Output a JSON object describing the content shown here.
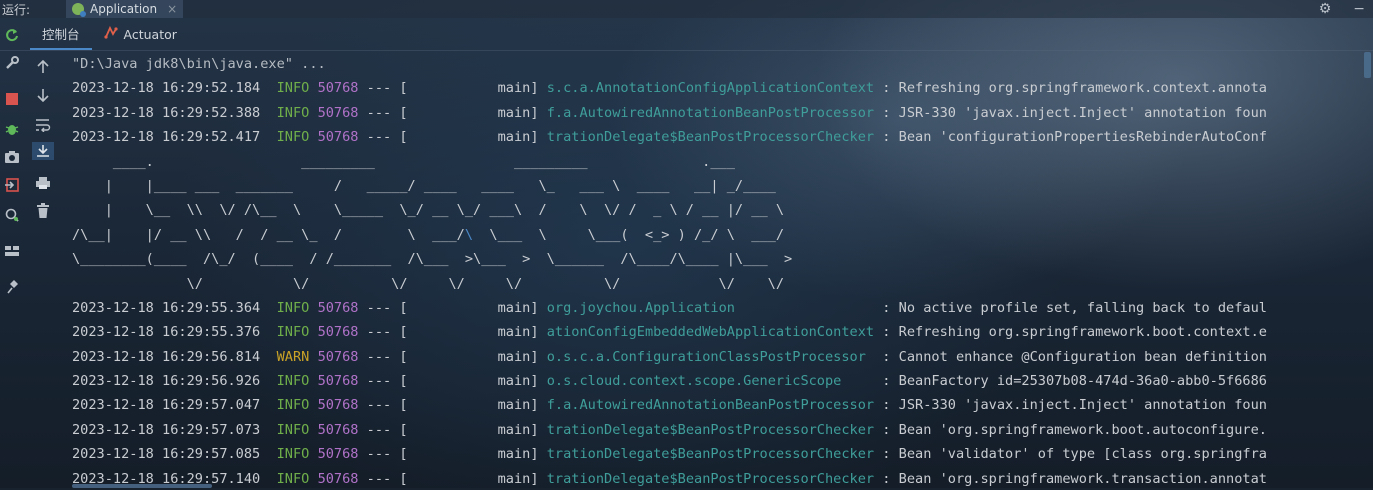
{
  "top_bar": {
    "run_label": "运行:",
    "tab_title": "Application",
    "close": "×",
    "gear": "⚙",
    "minus": "−"
  },
  "subtabs": {
    "console": "控制台",
    "actuator": "Actuator"
  },
  "command_line": "\"D:\\Java jdk8\\bin\\java.exe\" ...",
  "log_before": [
    {
      "ts": "2023-12-18 16:29:52.184",
      "level": "INFO",
      "pid": "50768",
      "sep": "--- [",
      "thread": "           main]",
      "logger": "s.c.a.AnnotationConfigApplicationContext",
      "msg": " : Refreshing org.springframework.context.annota"
    },
    {
      "ts": "2023-12-18 16:29:52.388",
      "level": "INFO",
      "pid": "50768",
      "sep": "--- [",
      "thread": "           main]",
      "logger": "f.a.AutowiredAnnotationBeanPostProcessor",
      "msg": " : JSR-330 'javax.inject.Inject' annotation foun"
    },
    {
      "ts": "2023-12-18 16:29:52.417",
      "level": "INFO",
      "pid": "50768",
      "sep": "--- [",
      "thread": "           main]",
      "logger": "trationDelegate$BeanPostProcessorChecker",
      "msg": " : Bean 'configurationPropertiesRebinderAutoConf"
    }
  ],
  "banner": [
    "     ____.                  _________                 _________              .___",
    "    |    |____ ___  _______     /   _____/ ____   ____   \\_   ___ \\  ____   __| _/____",
    "    |    \\__  \\\\  \\/ /\\__  \\    \\_____  \\_/ __ \\_/ ___\\  /    \\  \\/ /  _ \\ / __ |/ __ \\",
    "/\\__|    |/ __ \\\\   /  / __ \\_  /        \\  ___/",
    "\\________(____  /\\_/  (____  / /_______  /\\___  >\\___  >  \\______  /\\____/\\____ |\\___  >",
    "              \\/           \\/          \\/     \\/     \\/          \\/            \\/    \\/"
  ],
  "banner_line4_hl": "\\",
  "banner_line4_rest": "  \\___  \\     \\___(  <_> ) /_/ \\  ___/",
  "log_after": [
    {
      "ts": "2023-12-18 16:29:55.364",
      "level": "INFO",
      "pid": "50768",
      "sep": "--- [",
      "thread": "           main]",
      "logger": "org.joychou.Application                 ",
      "msg": " : No active profile set, falling back to defaul"
    },
    {
      "ts": "2023-12-18 16:29:55.376",
      "level": "INFO",
      "pid": "50768",
      "sep": "--- [",
      "thread": "           main]",
      "logger": "ationConfigEmbeddedWebApplicationContext",
      "msg": " : Refreshing org.springframework.boot.context.e"
    },
    {
      "ts": "2023-12-18 16:29:56.814",
      "level": "WARN",
      "pid": "50768",
      "sep": "--- [",
      "thread": "           main]",
      "logger": "o.s.c.a.ConfigurationClassPostProcessor ",
      "msg": " : Cannot enhance @Configuration bean definition"
    },
    {
      "ts": "2023-12-18 16:29:56.926",
      "level": "INFO",
      "pid": "50768",
      "sep": "--- [",
      "thread": "           main]",
      "logger": "o.s.cloud.context.scope.GenericScope    ",
      "msg": " : BeanFactory id=25307b08-474d-36a0-abb0-5f6686"
    },
    {
      "ts": "2023-12-18 16:29:57.047",
      "level": "INFO",
      "pid": "50768",
      "sep": "--- [",
      "thread": "           main]",
      "logger": "f.a.AutowiredAnnotationBeanPostProcessor",
      "msg": " : JSR-330 'javax.inject.Inject' annotation foun"
    },
    {
      "ts": "2023-12-18 16:29:57.073",
      "level": "INFO",
      "pid": "50768",
      "sep": "--- [",
      "thread": "           main]",
      "logger": "trationDelegate$BeanPostProcessorChecker",
      "msg": " : Bean 'org.springframework.boot.autoconfigure."
    },
    {
      "ts": "2023-12-18 16:29:57.085",
      "level": "INFO",
      "pid": "50768",
      "sep": "--- [",
      "thread": "           main]",
      "logger": "trationDelegate$BeanPostProcessorChecker",
      "msg": " : Bean 'validator' of type [class org.springfra"
    },
    {
      "ts": "2023-12-18 16:29:57.140",
      "level": "INFO",
      "pid": "50768",
      "sep": "--- [",
      "thread": "           main]",
      "logger": "trationDelegate$BeanPostProcessorChecker",
      "msg": " : Bean 'org.springframework.transaction.annotat"
    }
  ],
  "colors": {
    "info": "#6fae4a",
    "warn": "#c9a227",
    "pid": "#b072c8",
    "logger": "#3f9e9a",
    "accent": "#4a88c7"
  }
}
